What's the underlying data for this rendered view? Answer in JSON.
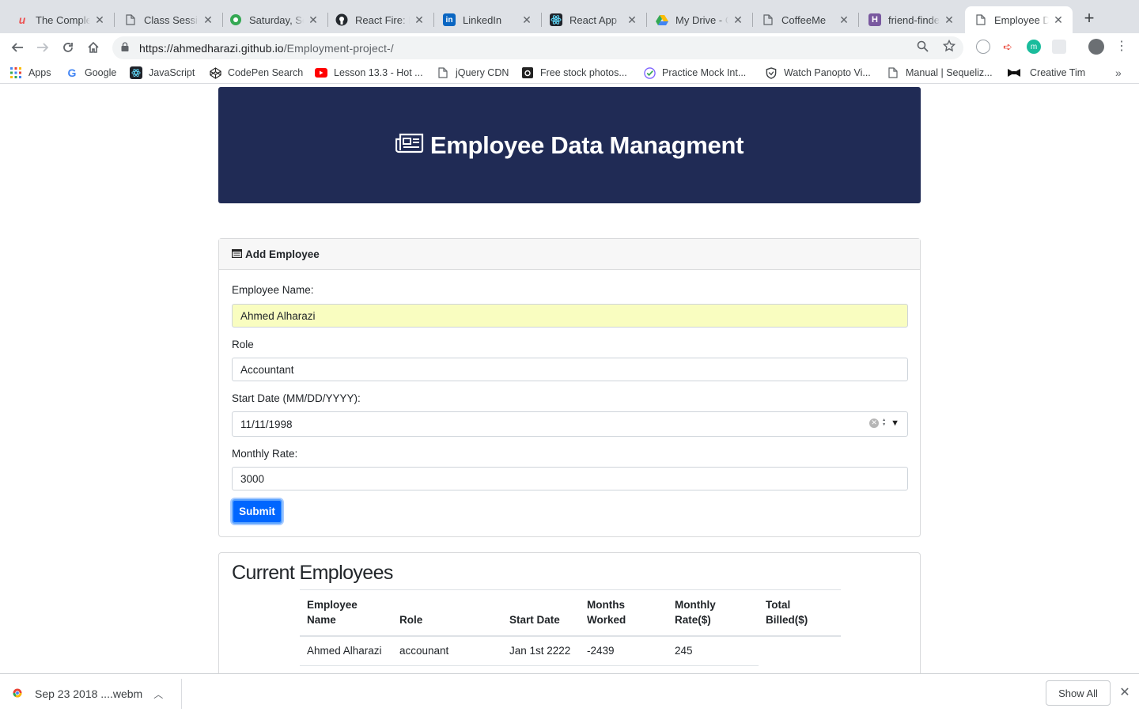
{
  "tabs": [
    {
      "title": "The Complete",
      "favicon": "udemy-icon",
      "color": "#ec5252"
    },
    {
      "title": "Class Session",
      "favicon": "page-icon",
      "color": "#5f6368"
    },
    {
      "title": "Saturday, Se",
      "favicon": "drive-circle-icon",
      "color": "#34a853"
    },
    {
      "title": "React Fire: M",
      "favicon": "github-icon",
      "color": "#24292e"
    },
    {
      "title": "LinkedIn",
      "favicon": "linkedin-icon",
      "color": "#0a66c2"
    },
    {
      "title": "React App",
      "favicon": "react-icon",
      "color": "#61dafb"
    },
    {
      "title": "My Drive - G",
      "favicon": "google-drive-icon",
      "color": "#fbbc04"
    },
    {
      "title": "CoffeeMe",
      "favicon": "page-icon",
      "color": "#5f6368"
    },
    {
      "title": "friend-finder",
      "favicon": "heroku-icon",
      "color": "#79589f"
    },
    {
      "title": "Employee Da",
      "favicon": "page-icon",
      "color": "#5f6368"
    }
  ],
  "address": {
    "host": "https://ahmedharazi.github.io",
    "path": "/Employment-project-/"
  },
  "bookmarks": [
    {
      "label": "Apps",
      "icon": "apps-grid-icon"
    },
    {
      "label": "Google",
      "icon": "google-icon"
    },
    {
      "label": "JavaScript",
      "icon": "react-icon"
    },
    {
      "label": "CodePen Search",
      "icon": "codepen-icon"
    },
    {
      "label": "Lesson 13.3 - Hot ...",
      "icon": "youtube-icon"
    },
    {
      "label": "jQuery CDN",
      "icon": "page-icon"
    },
    {
      "label": "Free stock photos...",
      "icon": "camera-icon"
    },
    {
      "label": "Practice Mock Int...",
      "icon": "check-circle-icon"
    },
    {
      "label": "Watch Panopto Vi...",
      "icon": "shield-icon"
    },
    {
      "label": "Manual | Sequeliz...",
      "icon": "page-icon"
    },
    {
      "label": "Creative Tim",
      "icon": "bowtie-icon"
    }
  ],
  "page": {
    "title": "Employee Data Managment",
    "form": {
      "heading": "Add Employee",
      "name_label": "Employee Name:",
      "name_value": "Ahmed Alharazi",
      "role_label": "Role",
      "role_value": "Accountant",
      "date_label": "Start Date (MM/DD/YYYY):",
      "date_value": "11/11/1998",
      "rate_label": "Monthly Rate:",
      "rate_value": "3000",
      "submit_label": "Submit"
    },
    "employees": {
      "heading": "Current Employees",
      "columns": [
        "Employee Name",
        "Role",
        "Start Date",
        "Months Worked",
        "Monthly Rate($)",
        "Total Billed($)"
      ],
      "rows": [
        [
          "Ahmed Alharazi",
          "accounant",
          "Jan 1st 2222",
          "-2439",
          "245",
          ""
        ]
      ]
    }
  },
  "downloads": {
    "file": "Sep 23 2018 ....webm",
    "show_all": "Show All"
  },
  "colors": {
    "jumbotron": "#202b55",
    "submit": "#0066ff",
    "autofill": "#f9fdc0"
  }
}
